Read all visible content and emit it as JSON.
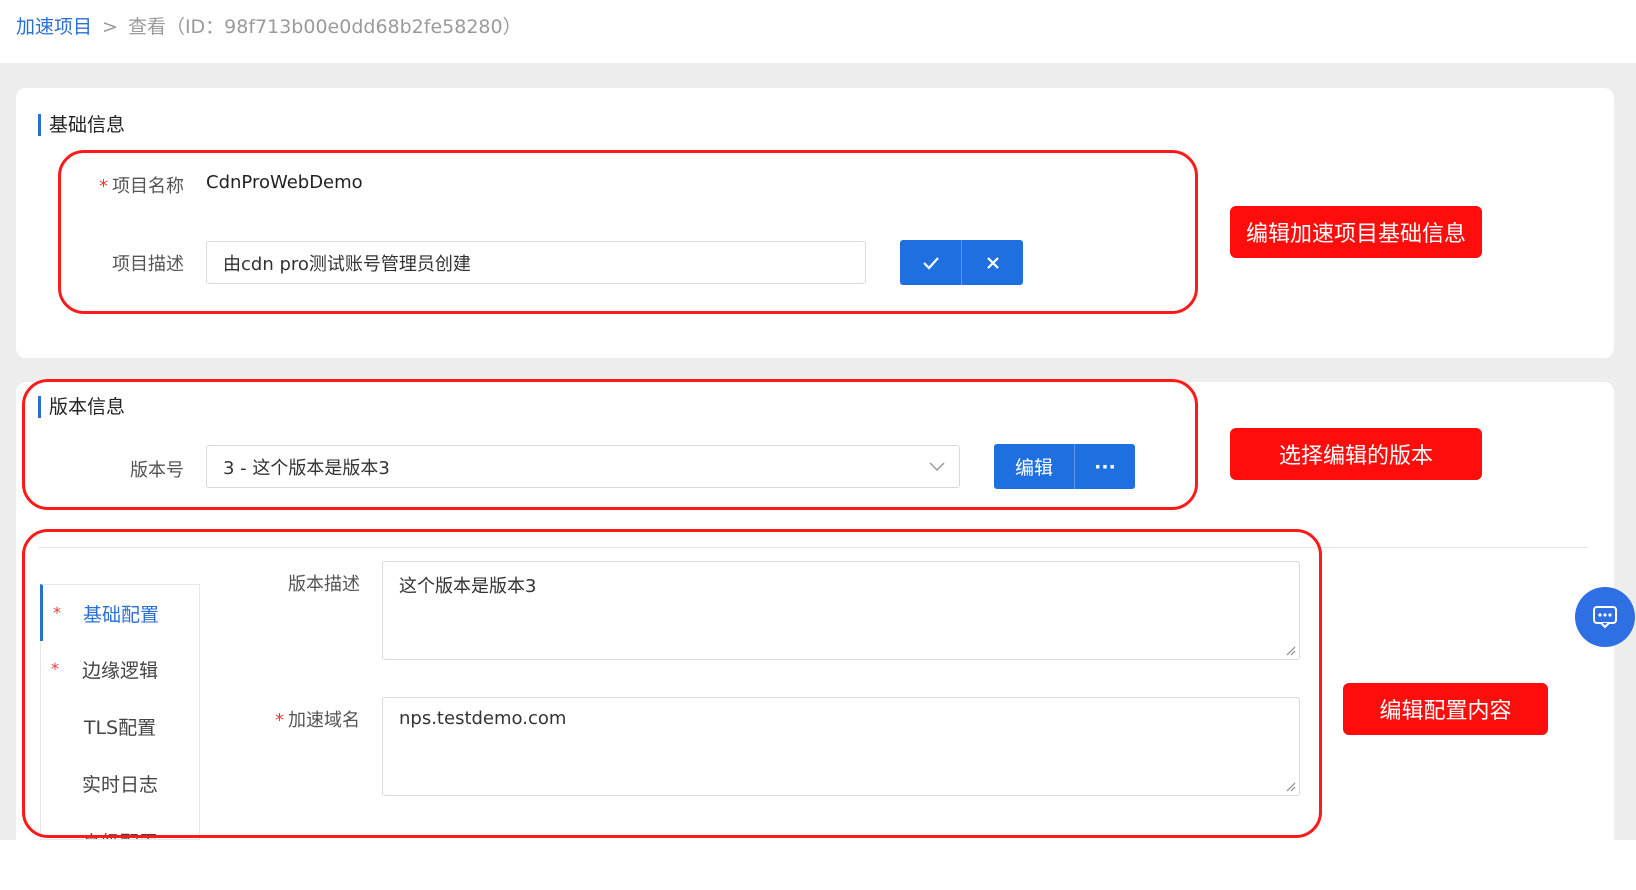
{
  "breadcrumb": {
    "parent": "加速项目",
    "separator": ">",
    "current": "查看（ID：98f713b00e0dd68b2fe58280）"
  },
  "basic_info": {
    "title": "基础信息",
    "name_label": "项目名称",
    "name_value": "CdnProWebDemo",
    "desc_label": "项目描述",
    "desc_value": "由cdn pro测试账号管理员创建"
  },
  "version_info": {
    "title": "版本信息",
    "version_label": "版本号",
    "version_selected": "3 - 这个版本是版本3",
    "edit_label": "编辑",
    "more_label": "···"
  },
  "side_menu": [
    {
      "label": "基础配置",
      "required": true,
      "active": true
    },
    {
      "label": "边缘逻辑",
      "required": true,
      "active": false
    },
    {
      "label": "TLS配置",
      "required": false,
      "active": false
    },
    {
      "label": "实时日志",
      "required": false,
      "active": false
    },
    {
      "label": "高级配置",
      "required": false,
      "active": false
    }
  ],
  "config": {
    "version_desc_label": "版本描述",
    "version_desc_value": "这个版本是版本3",
    "domain_label": "加速域名",
    "domain_value": "nps.testdemo.com"
  },
  "annotations": {
    "edit_basic": "编辑加速项目基础信息",
    "select_version": "选择编辑的版本",
    "edit_config": "编辑配置内容"
  },
  "colors": {
    "accent": "#1e6fe0",
    "annotation": "#ff0d0d",
    "required": "#e53935"
  },
  "icons": {
    "confirm": "check-icon",
    "cancel": "close-icon",
    "dropdown": "chevron-down-icon",
    "chat": "chat-icon"
  }
}
